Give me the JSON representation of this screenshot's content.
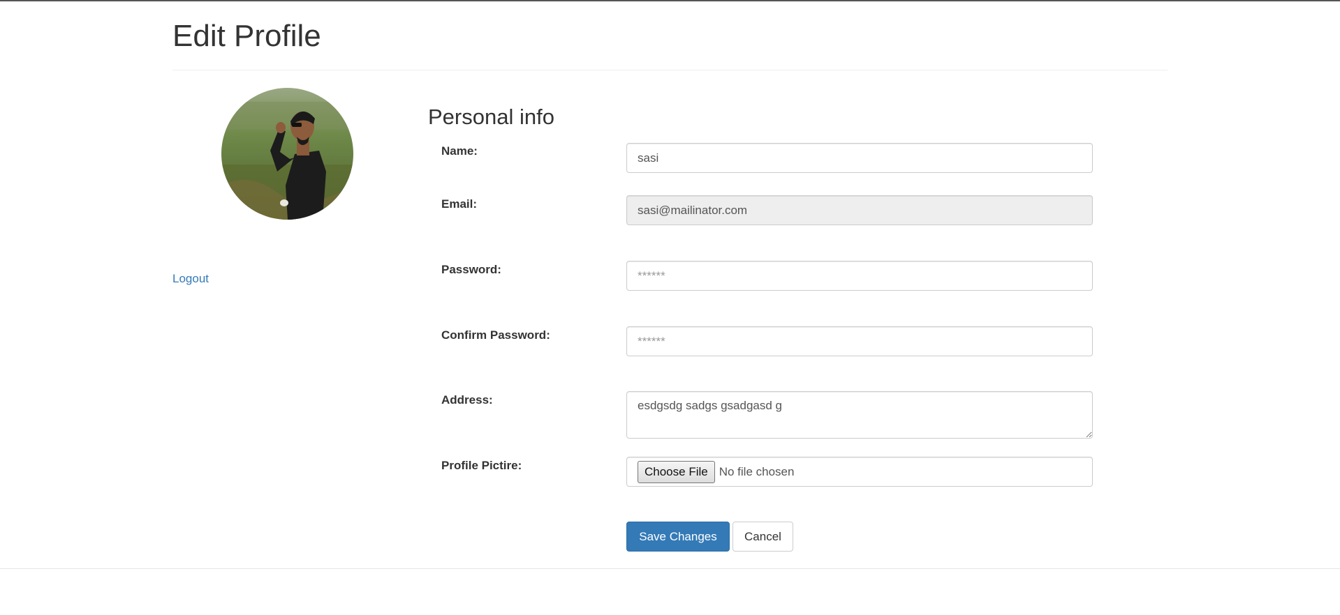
{
  "page": {
    "title": "Edit Profile"
  },
  "sidebar": {
    "avatar_alt": "profile photo",
    "logout_label": "Logout"
  },
  "form": {
    "section_title": "Personal info",
    "name": {
      "label": "Name:",
      "value": "sasi"
    },
    "email": {
      "label": "Email:",
      "value": "sasi@mailinator.com",
      "disabled": true
    },
    "password": {
      "label": "Password:",
      "value": "",
      "placeholder": "******"
    },
    "confirm_password": {
      "label": "Confirm Password:",
      "value": "",
      "placeholder": "******"
    },
    "address": {
      "label": "Address:",
      "value": "esdgsdg sadgs gsadgasd g"
    },
    "profile_picture": {
      "label": "Profile Pictire:",
      "button_label": "Choose File",
      "status": "No file chosen"
    },
    "save_label": "Save Changes",
    "cancel_label": "Cancel"
  },
  "colors": {
    "link": "#337ab7",
    "primary": "#337ab7",
    "disabled_bg": "#eeeeee",
    "border": "#cccccc"
  }
}
